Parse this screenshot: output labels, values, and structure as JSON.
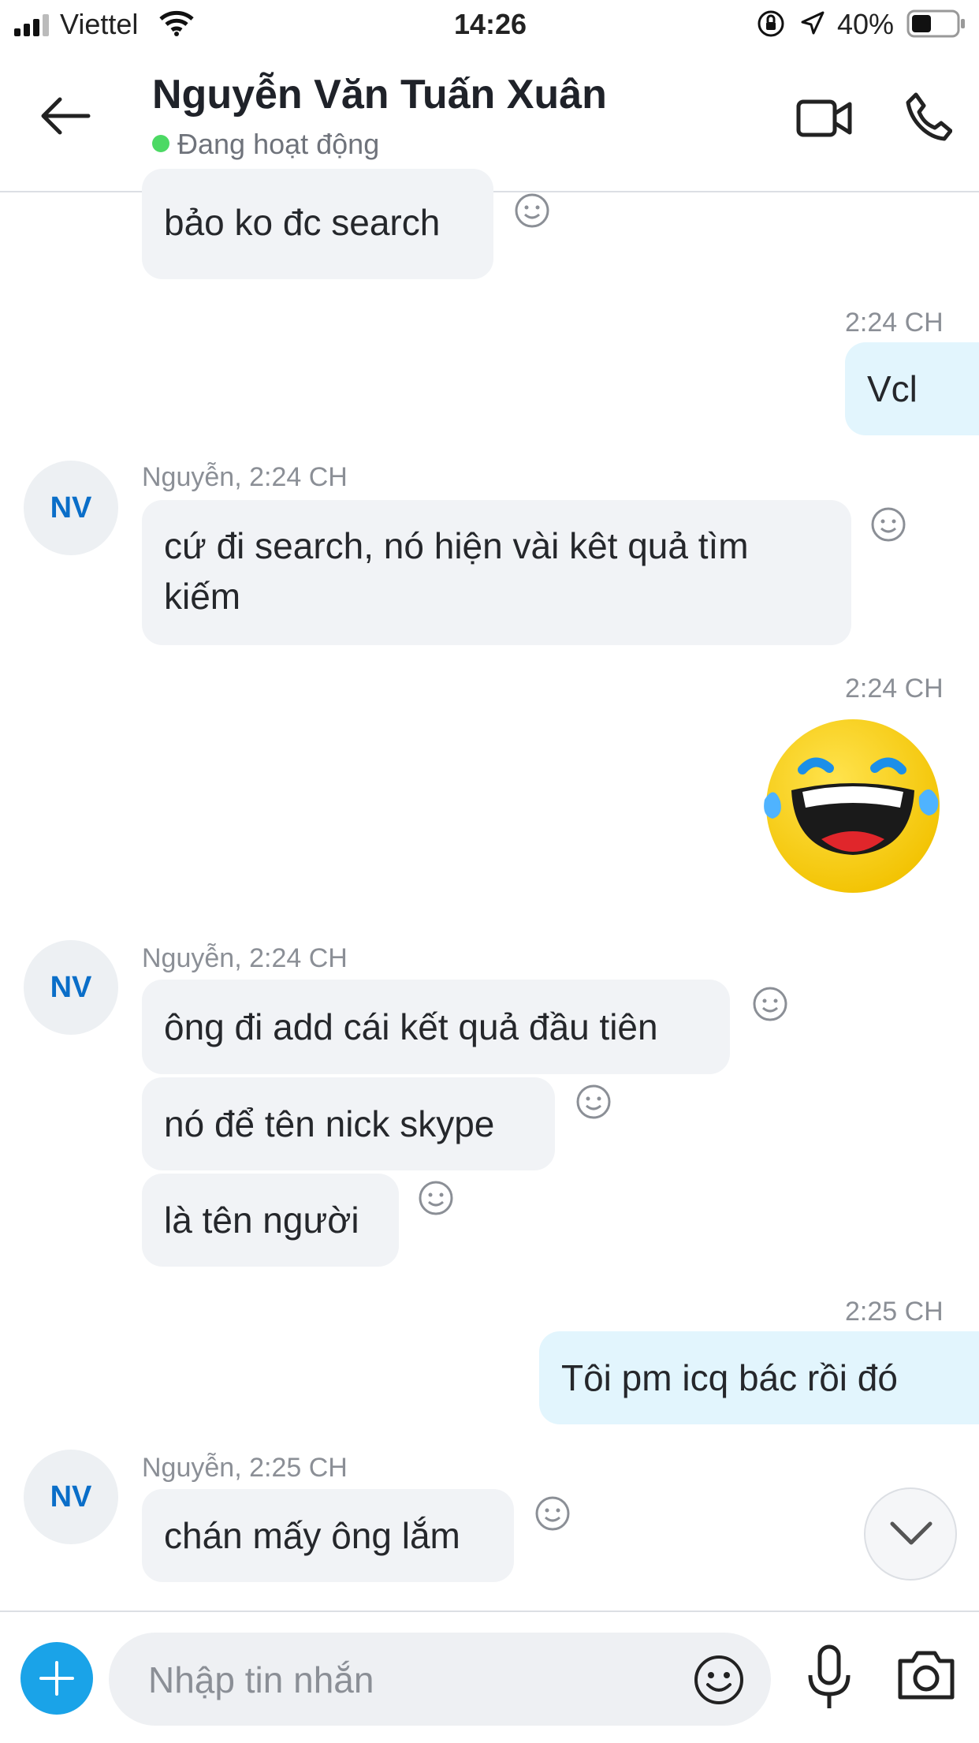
{
  "status_bar": {
    "carrier": "Viettel",
    "time": "14:26",
    "battery": "40%"
  },
  "header": {
    "contact_name": "Nguyễn Văn Tuấn Xuân",
    "presence": "Đang hoạt động"
  },
  "messages": [
    {
      "sender": "them",
      "text": "bảo ko đc search"
    },
    {
      "sender": "me",
      "timestamp": "2:24 CH",
      "text": "Vcl"
    },
    {
      "sender": "them",
      "avatar": "NV",
      "meta": "Nguyễn, 2:24 CH",
      "text_line1": "cứ đi search, nó hiện vài kêt quả tìm",
      "text_line2": "kiếm"
    },
    {
      "sender": "me",
      "timestamp": "2:24 CH",
      "type": "emoticon",
      "emoticon": "laughing-with-tears"
    },
    {
      "sender": "them",
      "avatar": "NV",
      "meta": "Nguyễn, 2:24 CH",
      "text": "ông đi add cái kết quả đầu tiên"
    },
    {
      "sender": "them",
      "text": "nó để tên nick skype"
    },
    {
      "sender": "them",
      "text": "là tên người"
    },
    {
      "sender": "me",
      "timestamp": "2:25 CH",
      "text": "Tôi pm icq bác rồi đó"
    },
    {
      "sender": "them",
      "avatar": "NV",
      "meta": "Nguyễn, 2:25 CH",
      "text": "chán mấy ông lắm"
    }
  ],
  "composer": {
    "placeholder": "Nhập tin nhắn"
  },
  "colors": {
    "accent": "#1aa3e8",
    "incoming_bubble": "#f1f3f6",
    "outgoing_bubble": "#e2f5fd",
    "online_dot": "#4cd964",
    "avatar_text": "#0a6ec8"
  }
}
